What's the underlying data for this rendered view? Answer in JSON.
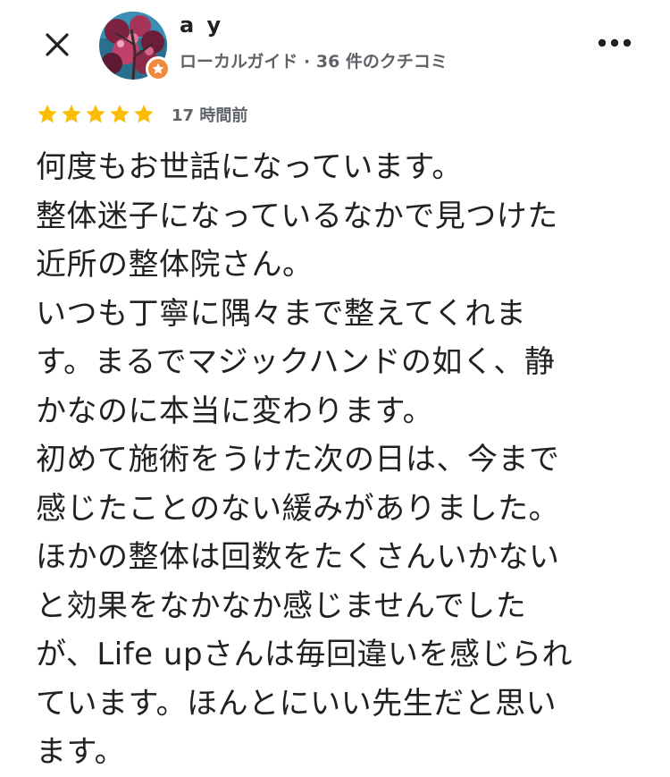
{
  "header": {
    "close_icon": "close-icon",
    "more_icon": "more-horizontal-icon",
    "reviewer": {
      "name": "a y",
      "meta": "ローカルガイド · 36 件のクチコミ",
      "avatar_icon": "avatar-photo",
      "badge_icon": "local-guide-star-icon",
      "badge_color": "#f0883e"
    }
  },
  "review": {
    "rating": 5,
    "max_rating": 5,
    "star_color": "#fbbc04",
    "time": "17 時間前",
    "lines": [
      "何度もお世話になっています。",
      "整体迷子になっているなかで見つけた",
      "近所の整体院さん。",
      "いつも丁寧に隅々まで整えてくれま",
      "す。まるでマジックハンドの如く、静",
      "かなのに本当に変わります。",
      "初めて施術をうけた次の日は、今まで",
      "感じたことのない緩みがありました。",
      "ほかの整体は回数をたくさんいかない",
      "と効果をなかなか感じませんでした",
      "が、Life upさんは毎回違いを感じられ",
      "ています。ほんとにいい先生だと思い",
      "ます。"
    ]
  }
}
